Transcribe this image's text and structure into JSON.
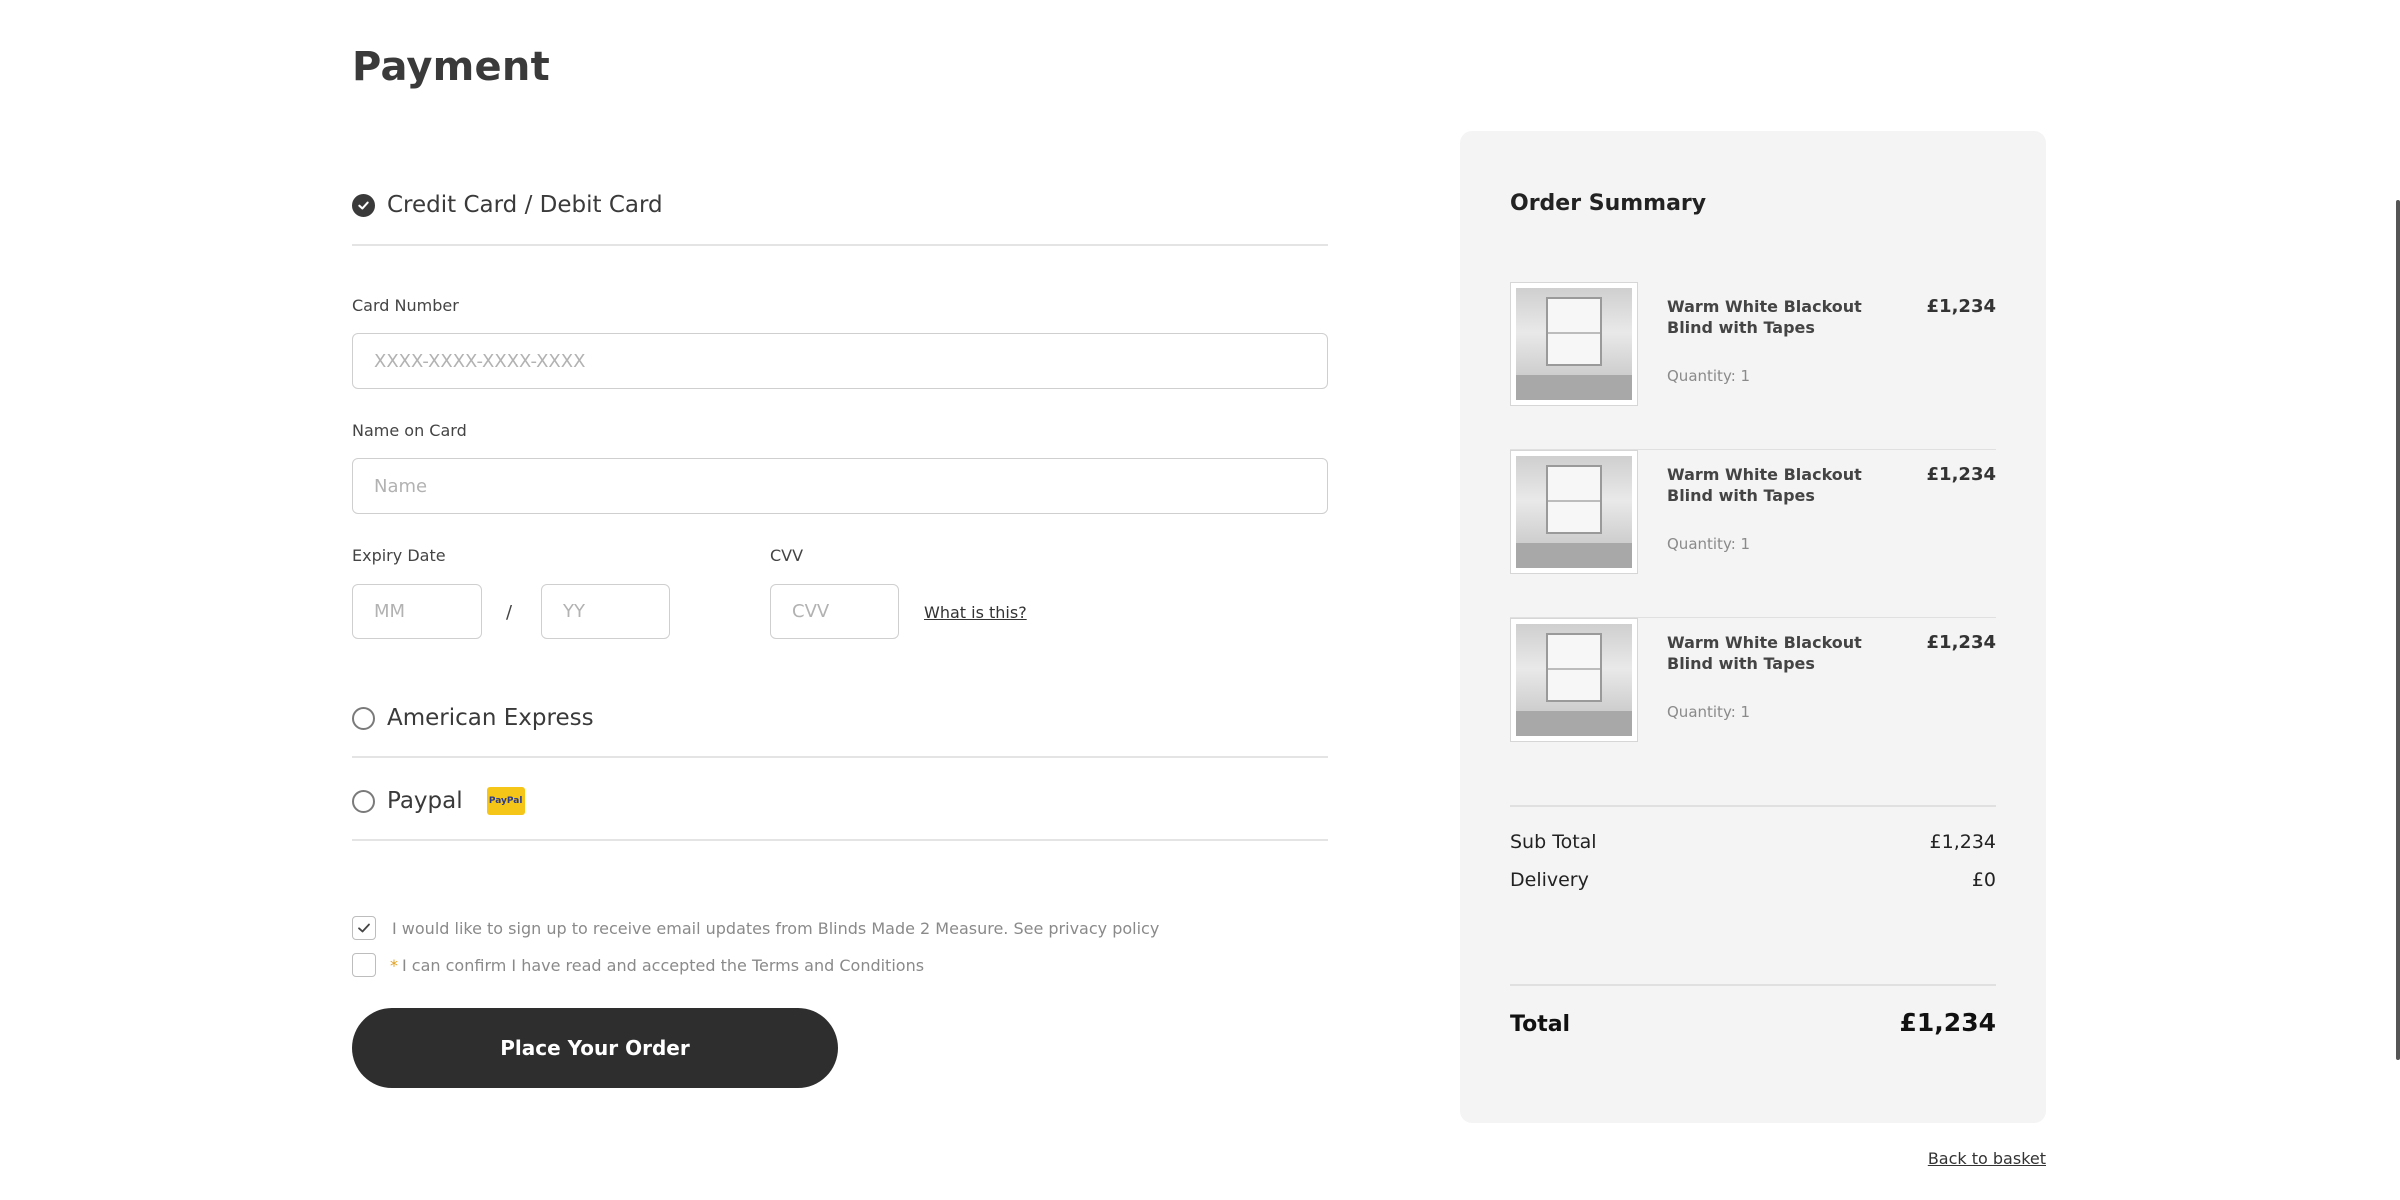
{
  "page": {
    "title": "Payment"
  },
  "payment_methods": {
    "credit_card": {
      "label": "Credit Card / Debit Card",
      "selected": true
    },
    "amex": {
      "label": "American Express",
      "selected": false
    },
    "paypal": {
      "label": "Paypal",
      "selected": false,
      "badge_text": "PayPal",
      "badge_color": "#f5c518"
    }
  },
  "card_form": {
    "card_number": {
      "label": "Card Number",
      "placeholder": "XXXX-XXXX-XXXX-XXXX",
      "value": ""
    },
    "name_on_card": {
      "label": "Name on Card",
      "placeholder": "Name",
      "value": ""
    },
    "expiry": {
      "label": "Expiry Date",
      "month_placeholder": "MM",
      "year_placeholder": "YY",
      "separator": "/"
    },
    "cvv": {
      "label": "CVV",
      "placeholder": "CVV",
      "help_link": "What is this?"
    }
  },
  "consents": {
    "newsletter": {
      "text": "I would like to sign up to receive email updates from Blinds Made 2 Measure. See privacy policy",
      "checked": true
    },
    "terms": {
      "required_marker": "*",
      "text": "I can confirm I have read and accepted the Terms and Conditions",
      "checked": false
    }
  },
  "actions": {
    "place_order": "Place Your Order",
    "back_to_basket": "Back to basket"
  },
  "order_summary": {
    "title": "Order Summary",
    "items": [
      {
        "name": "Warm White Blackout Blind with Tapes",
        "price": "£1,234",
        "quantity": "Quantity: 1"
      },
      {
        "name": "Warm White Blackout Blind with Tapes",
        "price": "£1,234",
        "quantity": "Quantity: 1"
      },
      {
        "name": "Warm White Blackout Blind with Tapes",
        "price": "£1,234",
        "quantity": "Quantity: 1"
      }
    ],
    "subtotal": {
      "label": "Sub Total",
      "value": "£1,234"
    },
    "delivery": {
      "label": "Delivery",
      "value": "£0"
    },
    "total": {
      "label": "Total",
      "value": "£1,234"
    }
  },
  "colors": {
    "button_dark": "#2e2e2e",
    "summary_bg": "#f4f4f4",
    "accent_star": "#e0a020"
  }
}
